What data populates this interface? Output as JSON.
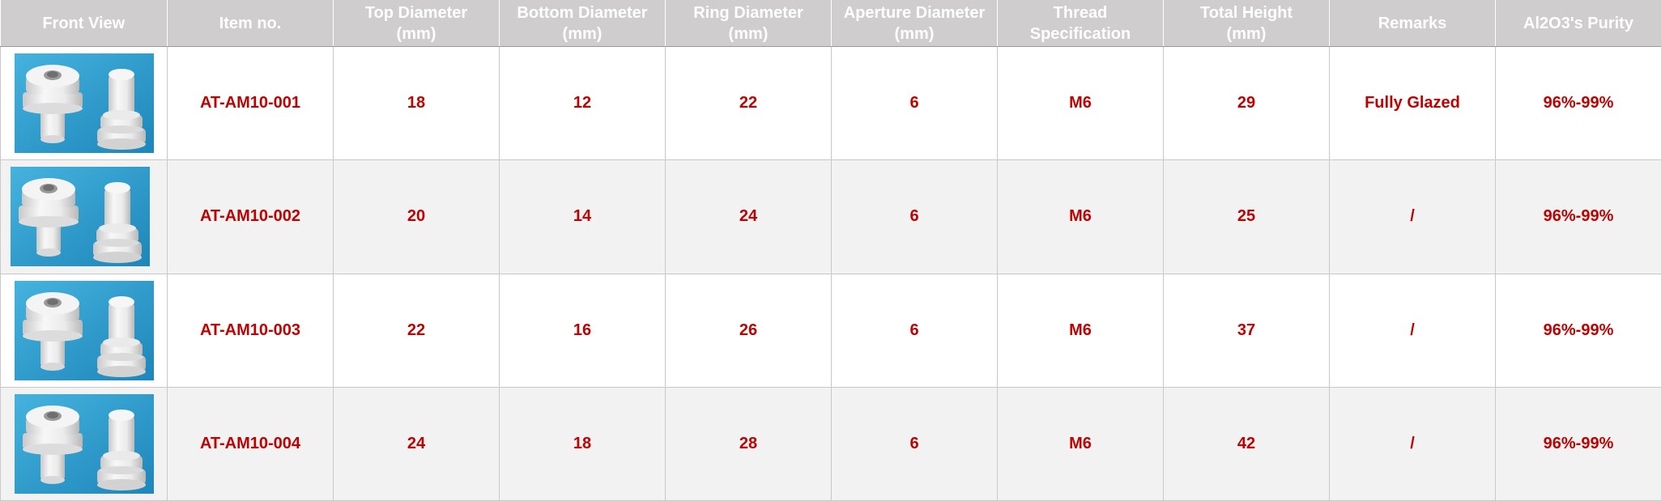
{
  "headers": [
    "Front View",
    "Item no.",
    "Top Diameter\n(mm)",
    "Bottom Diameter\n(mm)",
    "Ring Diameter\n(mm)",
    "Aperture Diameter\n(mm)",
    "Thread\nSpecification",
    "Total Height\n(mm)",
    "Remarks",
    "Al2O3's Purity"
  ],
  "rows": [
    {
      "item": "AT-AM10-001",
      "top": "18",
      "bottom": "12",
      "ring": "22",
      "aperture": "6",
      "thread": "M6",
      "height": "29",
      "remarks": "Fully Glazed",
      "purity": "96%-99%"
    },
    {
      "item": "AT-AM10-002",
      "top": "20",
      "bottom": "14",
      "ring": "24",
      "aperture": "6",
      "thread": "M6",
      "height": "25",
      "remarks": "/",
      "purity": "96%-99%"
    },
    {
      "item": "AT-AM10-003",
      "top": "22",
      "bottom": "16",
      "ring": "26",
      "aperture": "6",
      "thread": "M6",
      "height": "37",
      "remarks": "/",
      "purity": "96%-99%"
    },
    {
      "item": "AT-AM10-004",
      "top": "24",
      "bottom": "18",
      "ring": "28",
      "aperture": "6",
      "thread": "M6",
      "height": "42",
      "remarks": "/",
      "purity": "96%-99%"
    }
  ],
  "colors": {
    "header_bg": "#cfcdce",
    "header_text": "#ffffff",
    "value_text": "#c00000",
    "photo_bg": "#2b9ccf",
    "ceramic": "#eeeeee"
  },
  "icons": {
    "thumbnail": "ceramic-insulator-photo"
  }
}
